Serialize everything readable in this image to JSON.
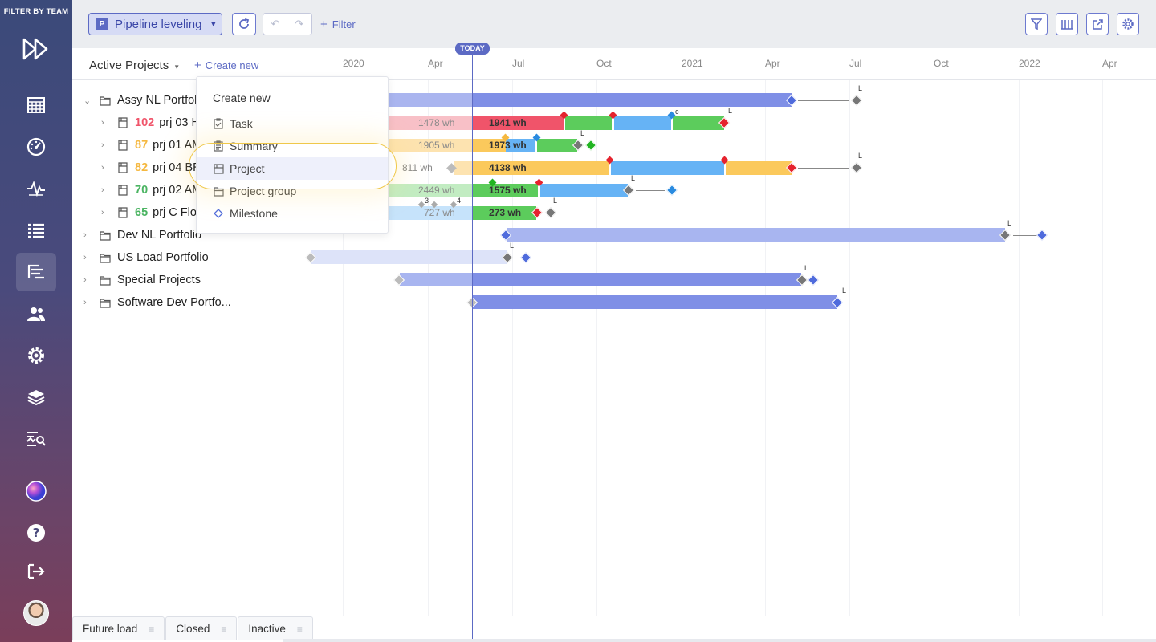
{
  "nav": {
    "filter_label": "FILTER BY TEAM",
    "items": [
      {
        "icon": "fast-forward-logo-icon"
      },
      {
        "icon": "calendar-grid-icon"
      },
      {
        "icon": "dashboard-gauge-icon"
      },
      {
        "icon": "activity-pulse-icon"
      },
      {
        "icon": "list-icon"
      },
      {
        "icon": "gantt-hierarchy-icon",
        "active": true
      },
      {
        "icon": "users-icon"
      },
      {
        "icon": "settings-gear-icon"
      },
      {
        "icon": "layers-icon"
      },
      {
        "icon": "analytics-search-icon"
      },
      {
        "icon": "color-orb-icon"
      },
      {
        "icon": "help-icon"
      },
      {
        "icon": "logout-icon"
      }
    ]
  },
  "toolbar": {
    "pipeline_badge": "P",
    "pipeline_label": "Pipeline leveling",
    "filter_label": "Filter",
    "right_icons": [
      "filter-funnel-icon",
      "columns-icon",
      "external-link-icon",
      "gear-icon"
    ]
  },
  "header": {
    "active_projects": "Active Projects",
    "create_new": "Create new",
    "today": "TODAY",
    "ticks": [
      "2020",
      "Apr",
      "Jul",
      "Oct",
      "2021",
      "Apr",
      "Jul",
      "Oct",
      "2022",
      "Apr"
    ]
  },
  "rows": [
    {
      "label": "Assy NL Portfolio",
      "type": "portfolio"
    },
    {
      "num": "102",
      "num_color": "#f0546a",
      "label": "prj 03 HI",
      "type": "project"
    },
    {
      "num": "87",
      "num_color": "#f5b840",
      "label": "prj 01 AM",
      "type": "project"
    },
    {
      "num": "82",
      "num_color": "#f5b840",
      "label": "prj 04 BR",
      "type": "project"
    },
    {
      "num": "70",
      "num_color": "#4bb462",
      "label": "prj 02 AM",
      "type": "project"
    },
    {
      "num": "65",
      "num_color": "#4bb462",
      "label": "prj C Flow",
      "type": "project"
    },
    {
      "label": "Dev NL Portfolio",
      "type": "portfolio"
    },
    {
      "label": "US Load Portfolio",
      "type": "portfolio"
    },
    {
      "label": "Special Projects",
      "type": "portfolio"
    },
    {
      "label": "Software Dev Portfo...",
      "type": "portfolio"
    }
  ],
  "bars": {
    "r1_past": "1478 wh",
    "r1_now": "1941 wh",
    "r2_past": "1905 wh",
    "r2_now": "1973 wh",
    "r3_past": "811 wh",
    "r3_now": "4138 wh",
    "r4_past": "2449 wh",
    "r4_now": "1575 wh",
    "r5_past": "727 wh",
    "r5_now": "273 wh",
    "marker_l": "L",
    "marker_c": "c",
    "marker_3": "3",
    "marker_4": "4"
  },
  "dropdown": {
    "title": "Create new",
    "items": [
      {
        "label": "Task",
        "icon": "task-clipboard-icon"
      },
      {
        "label": "Summary",
        "icon": "summary-clipboard-icon"
      },
      {
        "label": "Project",
        "icon": "project-folder-icon"
      },
      {
        "label": "Project group",
        "icon": "project-group-folder-icon"
      },
      {
        "label": "Milestone",
        "icon": "milestone-diamond-icon"
      }
    ]
  },
  "bottom_tabs": [
    "Future load",
    "Closed",
    "Inactive"
  ],
  "colors": {
    "accent": "#5c6ac4",
    "red": "#f0546a",
    "green": "#5ccc5c",
    "blue": "#66b3f5",
    "yellow": "#fbc95c",
    "portfolio_bar": "#7f8fe6"
  }
}
